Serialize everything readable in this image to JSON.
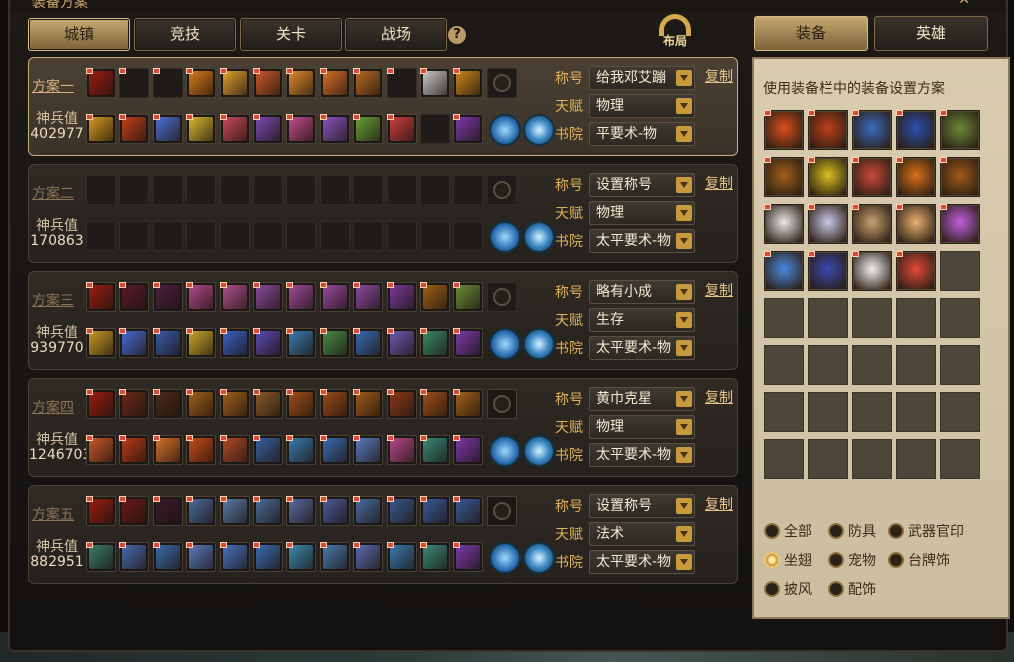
{
  "window": {
    "title": "装备方案",
    "close_glyph": "✕"
  },
  "main_tabs": [
    {
      "label": "城镇",
      "active": true
    },
    {
      "label": "竞技",
      "active": false
    },
    {
      "label": "关卡",
      "active": false
    },
    {
      "label": "战场",
      "active": false
    }
  ],
  "help_glyph": "?",
  "layout_badge": "布局",
  "field_labels": {
    "title": "称号",
    "talent": "天赋",
    "academy": "书院"
  },
  "power_label": "神兵值",
  "copy_label": "复制",
  "plans": [
    {
      "name": "方案一",
      "power": "402977",
      "title": "给我邓艾蹦",
      "talent": "物理",
      "academy": "平要术-物",
      "active": true,
      "filled_top": true
    },
    {
      "name": "方案二",
      "power": "170863",
      "title": "设置称号",
      "talent": "物理",
      "academy": "太平要术-物",
      "active": false,
      "filled_top": false
    },
    {
      "name": "方案三",
      "power": "939770",
      "title": "略有小成",
      "talent": "生存",
      "academy": "太平要术-物",
      "active": false,
      "filled_top": true
    },
    {
      "name": "方案四",
      "power": "1246703",
      "title": "黄巾克星",
      "talent": "物理",
      "academy": "太平要术-物",
      "active": false,
      "filled_top": true
    },
    {
      "name": "方案五",
      "power": "882951",
      "title": "设置称号",
      "talent": "法术",
      "academy": "太平要术-物",
      "active": false,
      "filled_top": true
    }
  ],
  "right_tabs": [
    {
      "label": "装备",
      "active": true
    },
    {
      "label": "英雄",
      "active": false
    }
  ],
  "right_panel": {
    "instruction": "使用装备栏中的装备设置方案",
    "filled_slots": 19,
    "total_slots": 40,
    "filters": [
      {
        "label": "全部",
        "selected": false
      },
      {
        "label": "防具",
        "selected": false
      },
      {
        "label": "武器官印",
        "selected": false
      },
      {
        "label": "坐翅",
        "selected": true
      },
      {
        "label": "宠物",
        "selected": false
      },
      {
        "label": "台牌饰",
        "selected": false
      },
      {
        "label": "披风",
        "selected": false
      },
      {
        "label": "配饰",
        "selected": false
      }
    ]
  },
  "colors": {
    "accent_gold": "#d2a94f",
    "label_orange": "#e0b25a",
    "panel_bg": "#d9ccb0"
  }
}
